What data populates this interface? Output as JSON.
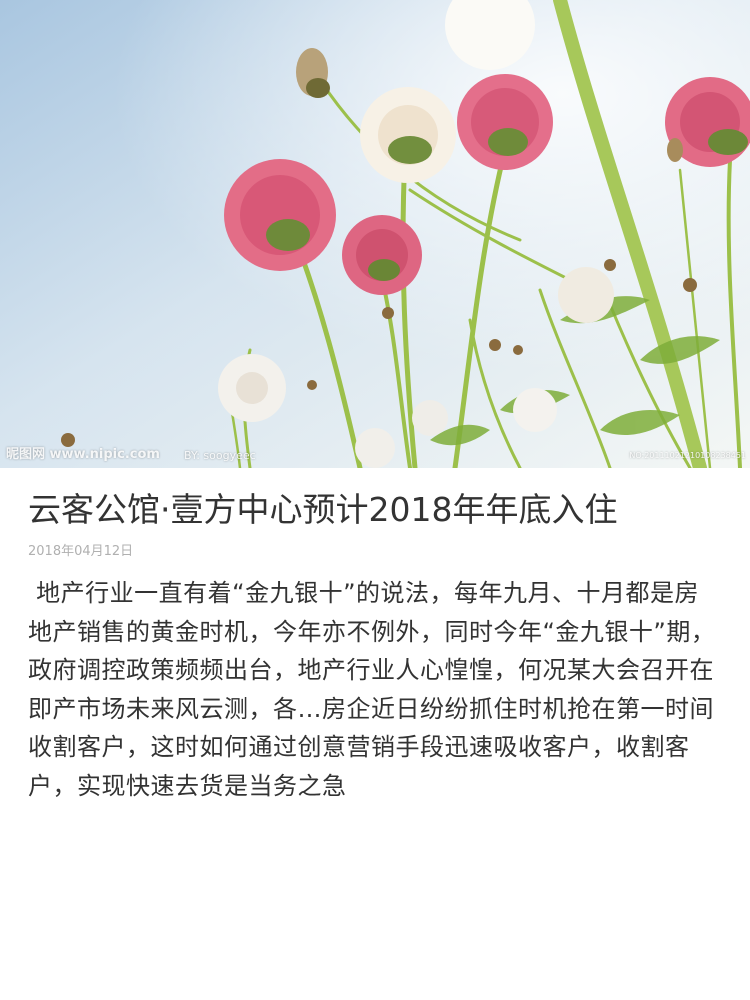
{
  "hero": {
    "watermark_site": "昵图网 www.nipic.com",
    "watermark_by": "BY: soogyeec",
    "watermark_no": "NO:20111021210108238451"
  },
  "article": {
    "title": "云客公馆·壹方中心预计2018年年底入住",
    "date": "2018年04月12日",
    "body": " 地产行业一直有着“金九银十”的说法，每年九月、十月都是房地产销售的黄金时机，今年亦不例外，同时今年“金九银十”期，政府调控政策频频出台，地产行业人心惶惶，何况某大会召开在即产市场未来风云测，各…房企近日纷纷抓住时机抢在第一时间收割客户，这时如何通过创意营销手段迅速吸收客户，收割客户，实现快速去货是当务之急"
  }
}
